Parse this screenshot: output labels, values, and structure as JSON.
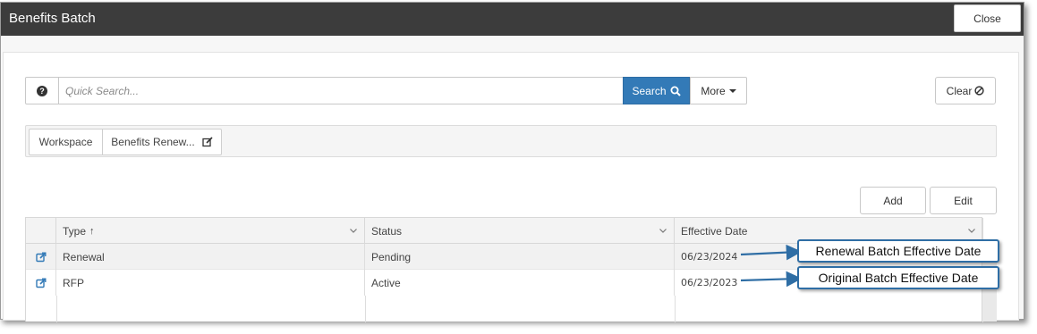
{
  "window": {
    "title": "Benefits Batch",
    "close_label": "Close"
  },
  "search": {
    "help_icon": "question-circle-icon",
    "placeholder": "Quick Search...",
    "value": "",
    "search_label": "Search",
    "more_label": "More",
    "clear_label": "Clear"
  },
  "breadcrumb": {
    "items": [
      {
        "label": "Workspace"
      },
      {
        "label": "Benefits Renew..."
      }
    ]
  },
  "actions": {
    "add_label": "Add",
    "edit_label": "Edit"
  },
  "grid": {
    "columns": [
      {
        "label": "Type",
        "sort": "ascending"
      },
      {
        "label": "Status"
      },
      {
        "label": "Effective Date"
      }
    ],
    "rows": [
      {
        "type": "Renewal",
        "status": "Pending",
        "effective_date": "06/23/2024"
      },
      {
        "type": "RFP",
        "status": "Active",
        "effective_date": "06/23/2023"
      }
    ]
  },
  "callouts": {
    "renewal": "Renewal Batch Effective Date",
    "original": "Original Batch Effective Date"
  },
  "colors": {
    "titlebar": "#3c3c3c",
    "primary": "#337ab7",
    "callout_border": "#2f6ea5"
  }
}
